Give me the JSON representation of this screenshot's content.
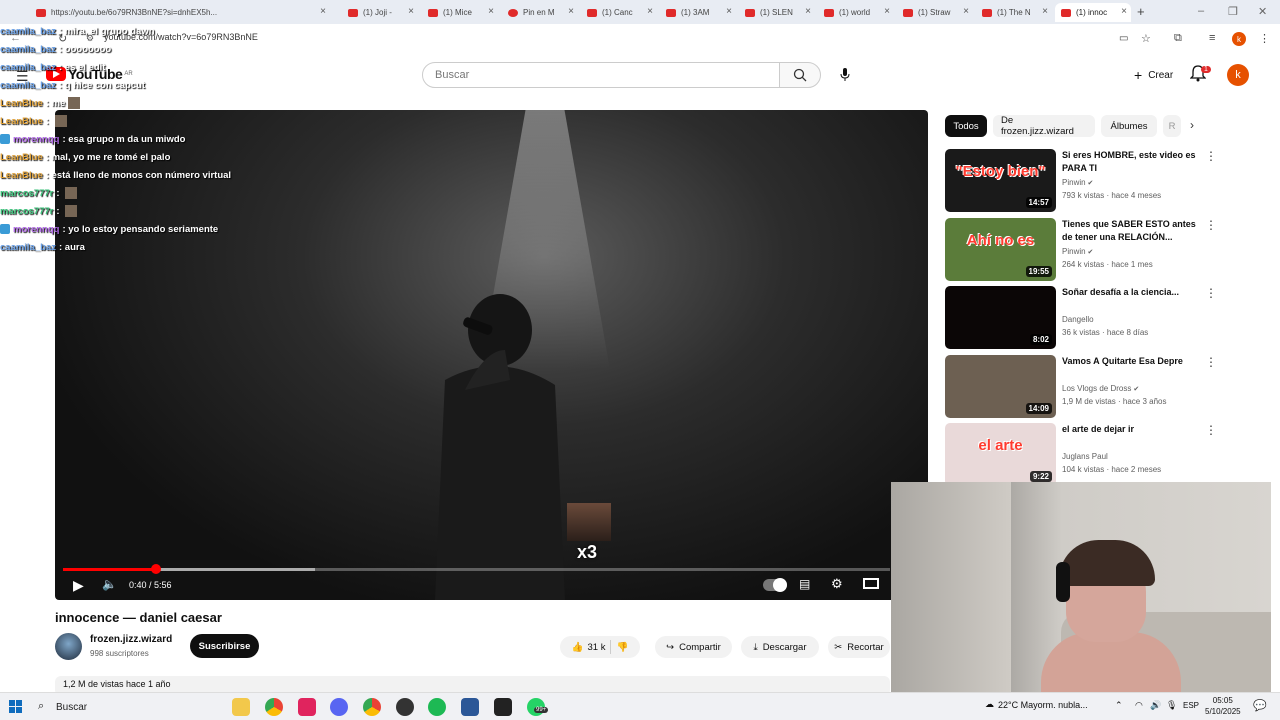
{
  "browser": {
    "tabs": [
      {
        "label": "https://youtu.be/6o79RN3BnNE?si=dnhEX5h..."
      },
      {
        "label": "(1) Joji -"
      },
      {
        "label": "(1) Mice"
      },
      {
        "label": "Pin en M"
      },
      {
        "label": "(1) Canc"
      },
      {
        "label": "(1) 3AM"
      },
      {
        "label": "(1) SLEN"
      },
      {
        "label": "(1) world"
      },
      {
        "label": "(1) Straw"
      },
      {
        "label": "(1) The N"
      },
      {
        "label": "(1) innoc"
      }
    ],
    "new_tab": "+",
    "url": "youtube.com/watch?v=6o79RN3BnNE",
    "profile_initial": "k"
  },
  "youtube": {
    "logo_text": "YouTube",
    "logo_region": "AR",
    "search_placeholder": "Buscar",
    "create_label": "Crear",
    "notifications_count": "1",
    "avatar_initial": "k"
  },
  "chat": {
    "messages": [
      {
        "user": "caamila_baz",
        "user_color": "#6aa0e6",
        "text": "mira, el grupo dawn",
        "badge": false,
        "emote": false
      },
      {
        "user": "caamila_baz",
        "user_color": "#6aa0e6",
        "text": "oooooooo",
        "badge": false,
        "emote": false
      },
      {
        "user": "caamila_baz",
        "user_color": "#6aa0e6",
        "text": "es el edit",
        "badge": false,
        "emote": false
      },
      {
        "user": "caamila_baz",
        "user_color": "#6aa0e6",
        "text": "q hice con capcut",
        "badge": false,
        "emote": false
      },
      {
        "user": "LeanBlue",
        "user_color": "#e0a23a",
        "text": "me",
        "badge": false,
        "emote": true
      },
      {
        "user": "LeanBlue",
        "user_color": "#e0a23a",
        "text": "",
        "badge": false,
        "emote": true
      },
      {
        "user": "morennqq",
        "user_color": "#b06ae6",
        "text": "esa grupo m da un miwdo",
        "badge": true,
        "emote": false
      },
      {
        "user": "LeanBlue",
        "user_color": "#e0a23a",
        "text": "mal, yo me re tomé el palo",
        "badge": false,
        "emote": false
      },
      {
        "user": "LeanBlue",
        "user_color": "#e0a23a",
        "text": "está lleno de monos con número virtual",
        "badge": false,
        "emote": false
      },
      {
        "user": "marcos777r",
        "user_color": "#3ac27a",
        "text": "",
        "badge": false,
        "emote": true
      },
      {
        "user": "marcos777r",
        "user_color": "#3ac27a",
        "text": "",
        "badge": false,
        "emote": true
      },
      {
        "user": "morennqq",
        "user_color": "#b06ae6",
        "text": "yo lo estoy pensando seriamente",
        "badge": true,
        "emote": false
      },
      {
        "user": "caamila_baz",
        "user_color": "#6aa0e6",
        "text": "aura",
        "badge": false,
        "emote": false
      }
    ]
  },
  "player": {
    "time": "0:40 / 5:56",
    "progress": 0.112,
    "buffered": 0.305,
    "emote_multiplier": "x3"
  },
  "video": {
    "title": "innocence — daniel caesar",
    "channel": "frozen.jizz.wizard",
    "subscribers": "998 suscriptores",
    "subscribe_label": "Suscribirse",
    "likes": "31 k",
    "share_label": "Compartir",
    "download_label": "Descargar",
    "clip_label": "Recortar",
    "views_date": "1,2 M de vistas  hace 1 año"
  },
  "sidebar": {
    "chips": [
      {
        "label": "Todos"
      },
      {
        "label": "De frozen.jizz.wizard"
      },
      {
        "label": "Álbumes"
      },
      {
        "label": "R"
      }
    ],
    "recommendations": [
      {
        "title": "Si eres HOMBRE, este video es PARA TI",
        "channel": "Pinwin",
        "verified": true,
        "meta": "793 k vistas · hace 4 meses",
        "duration": "14:57",
        "thumb_text": "\"Estoy bien\"",
        "thumb_bg": "#1a1a1a"
      },
      {
        "title": "Tienes que SABER ESTO antes de tener una RELACIÓN...",
        "channel": "Pinwin",
        "verified": true,
        "meta": "264 k vistas · hace 1 mes",
        "duration": "19:55",
        "thumb_text": "Ahí no es",
        "thumb_bg": "#5b7c3a"
      },
      {
        "title": "Soñar desafía a la ciencia...",
        "channel": "Dangello",
        "verified": false,
        "meta": "36 k vistas · hace 8 días",
        "duration": "8:02",
        "thumb_text": "",
        "thumb_bg": "#0b0606"
      },
      {
        "title": "Vamos A Quitarte Esa Depre",
        "channel": "Los Vlogs de Dross",
        "verified": true,
        "meta": "1,9 M de vistas · hace 3 años",
        "duration": "14:09",
        "thumb_text": "",
        "thumb_bg": "#6d6052"
      },
      {
        "title": "el arte de dejar ir",
        "channel": "Juglans Paul",
        "verified": false,
        "meta": "104 k vistas · hace 2 meses",
        "duration": "9:22",
        "thumb_text": "el arte",
        "thumb_bg": "#e9d9d9"
      }
    ]
  },
  "taskbar": {
    "search_label": "Buscar",
    "badge": "99+",
    "weather": "22°C  Mayorm. nubla...",
    "lang": "ESP",
    "time": "05:05",
    "date": "5/10/2025"
  }
}
